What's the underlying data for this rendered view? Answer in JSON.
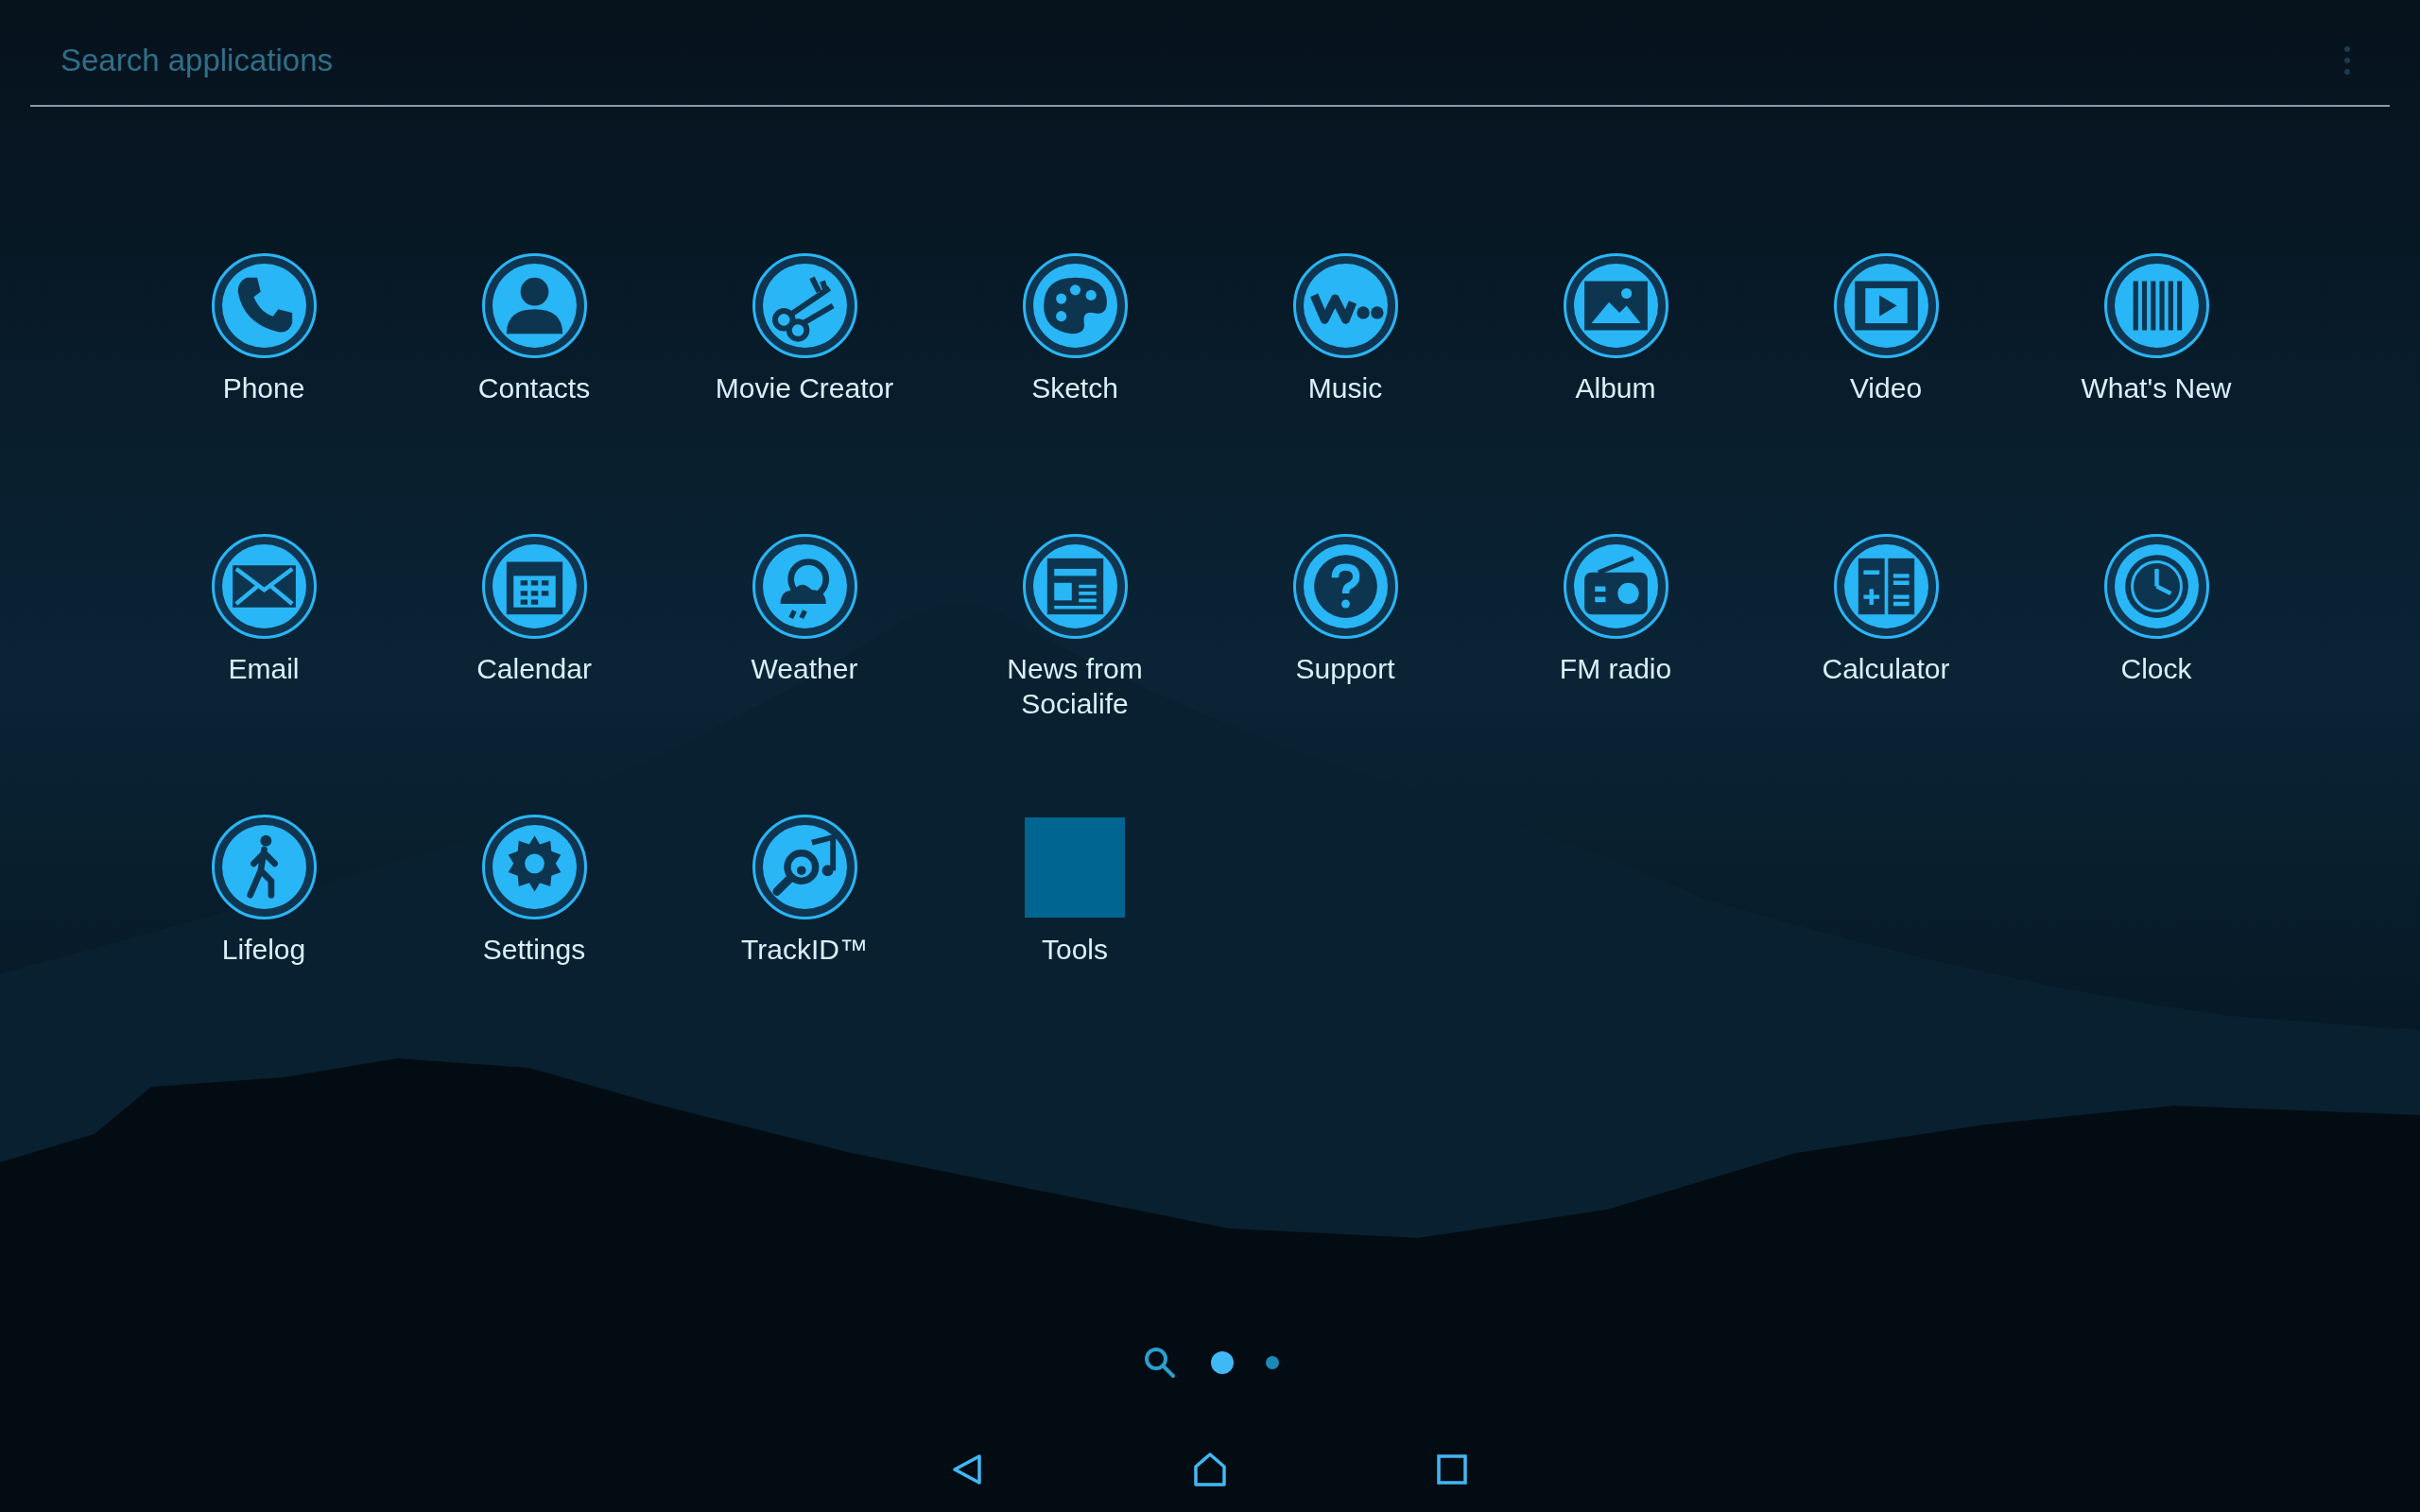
{
  "search": {
    "placeholder": "Search applications"
  },
  "apps": [
    {
      "label": "Phone",
      "kind": "app"
    },
    {
      "label": "Contacts",
      "kind": "app"
    },
    {
      "label": "Movie Creator",
      "kind": "app"
    },
    {
      "label": "Sketch",
      "kind": "app"
    },
    {
      "label": "Music",
      "kind": "app"
    },
    {
      "label": "Album",
      "kind": "app"
    },
    {
      "label": "Video",
      "kind": "app"
    },
    {
      "label": "What's New",
      "kind": "app"
    },
    {
      "label": "Email",
      "kind": "app"
    },
    {
      "label": "Calendar",
      "kind": "app"
    },
    {
      "label": "Weather",
      "kind": "app"
    },
    {
      "label": "News from Socialife",
      "kind": "app"
    },
    {
      "label": "Support",
      "kind": "app"
    },
    {
      "label": "FM radio",
      "kind": "app"
    },
    {
      "label": "Calculator",
      "kind": "app"
    },
    {
      "label": "Clock",
      "kind": "app"
    },
    {
      "label": "Lifelog",
      "kind": "app"
    },
    {
      "label": "Settings",
      "kind": "app"
    },
    {
      "label": "TrackID™",
      "kind": "app"
    },
    {
      "label": "Tools",
      "kind": "folder"
    }
  ],
  "pages": [
    {
      "selected": true
    },
    {
      "selected": false
    }
  ]
}
